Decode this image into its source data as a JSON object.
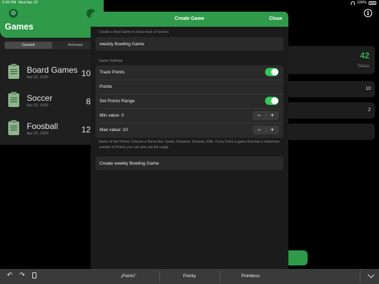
{
  "status": {
    "time": "3:26 PM",
    "date": "Wed Apr 22",
    "battery": "100%"
  },
  "sidebar": {
    "title": "Games",
    "segments": [
      "Current",
      "Archived"
    ],
    "games": [
      {
        "name": "Board Games",
        "date": "Apr 22, 2020",
        "count": "10"
      },
      {
        "name": "Soccer",
        "date": "Apr 22, 2020",
        "count": "8"
      },
      {
        "name": "Foosball",
        "date": "Apr 22, 2020",
        "count": "12"
      }
    ]
  },
  "detail": {
    "big_number": "42",
    "label": "Tobias",
    "row1_value": "10",
    "row2_value": "2"
  },
  "modal": {
    "title": "Create Game",
    "close_label": "Close",
    "intro": "Create a New Game to keep track of Scores",
    "game_name_value": "weekly Bowling Game",
    "settings_label": "Game Settings",
    "track_points_label": "Track Points",
    "track_points_on": true,
    "points_value": "Points",
    "set_range_label": "Set Points Range",
    "set_range_on": true,
    "min_label": "Min value: 0",
    "max_label": "Max value: 10",
    "help_text": "Name of the Points: Choose a Name like: Goals, Distance, Rounds, Kills. If you Track a game that has a maximum number of Points you can also set the range",
    "create_label": "Create weekly Bowling Game"
  },
  "keyboard": {
    "suggestions": [
      "„Points\"",
      "Pointy",
      "Pointless"
    ]
  }
}
